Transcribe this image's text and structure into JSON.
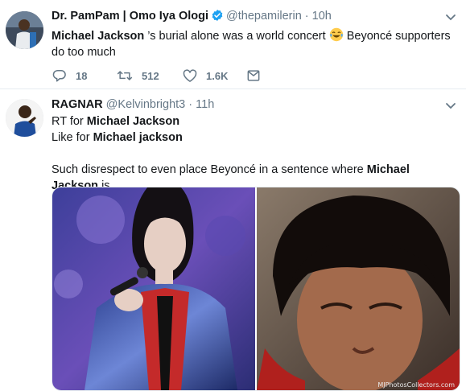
{
  "tweets": [
    {
      "name": "Dr. PamPam | Omo Iya Ologi",
      "handle": "@thepamilerin",
      "separator": "·",
      "time": "10h",
      "text_parts": {
        "t1": "Michael Jackson",
        "t2": " ’s burial alone was a world concert ",
        "t3": " Beyoncé supporters do too much"
      },
      "emoji": "face-with-tears-of-joy",
      "replies": "18",
      "retweets": "512",
      "likes": "1.6K"
    },
    {
      "name": "RAGNAR",
      "handle": "@Kelvinbright3",
      "separator": "·",
      "time": "11h",
      "lines": {
        "l1a": "RT for ",
        "l1b": "Michael Jackson",
        "l2a": "Like for ",
        "l2b": "Michael jackson",
        "l3a": "Such disrespect to even place Beyoncé in a sentence where ",
        "l3b": "Michael Jackson",
        "l3c": " is.."
      },
      "media_watermark": "MJPhotosCollectors.com"
    }
  ],
  "icons": [
    "verified-badge-icon",
    "chevron-down-icon",
    "reply-icon",
    "retweet-icon",
    "like-icon",
    "direct-message-icon"
  ],
  "colors": {
    "verified": "#1da1f2",
    "secondary_text": "#657786",
    "divider": "#e6ecf0"
  }
}
